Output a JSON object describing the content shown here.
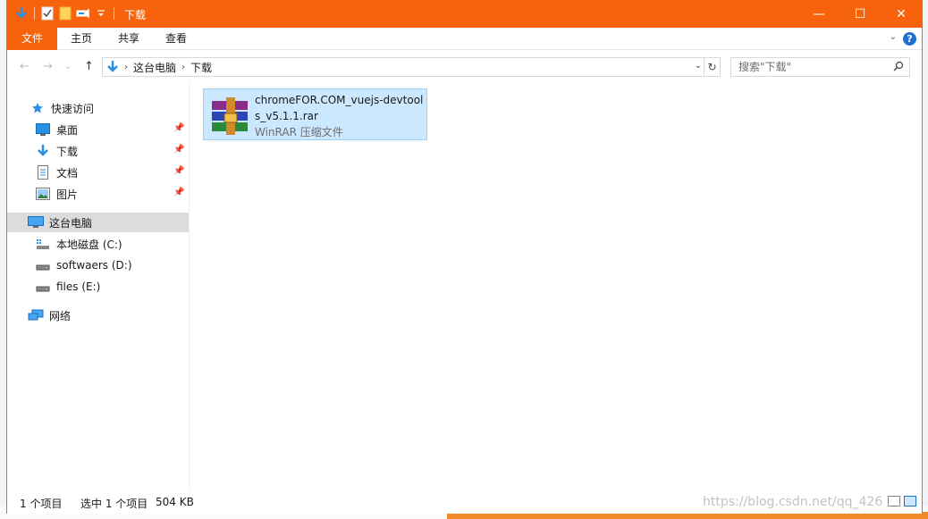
{
  "titlebar": {
    "title": "下载",
    "qat_icons": [
      "download-arrow-icon",
      "properties-check-icon",
      "new-folder-icon",
      "rename-icon",
      "customize-dropdown-icon"
    ],
    "controls": {
      "minimize": "—",
      "maximize": "☐",
      "close": "✕"
    }
  },
  "ribbon": {
    "tabs": [
      {
        "label": "文件",
        "active": true
      },
      {
        "label": "主页",
        "active": false
      },
      {
        "label": "共享",
        "active": false
      },
      {
        "label": "查看",
        "active": false
      }
    ],
    "help": "?"
  },
  "address": {
    "back": "←",
    "forward": "→",
    "recent": "⌄",
    "up": "↑",
    "breadcrumb": [
      "这台电脑",
      "下载"
    ],
    "separator": "›",
    "refresh": "↻"
  },
  "search": {
    "placeholder": "搜索\"下载\""
  },
  "nav": {
    "quick_access": {
      "label": "快速访问"
    },
    "pinned": [
      {
        "label": "桌面",
        "icon": "desktop-icon"
      },
      {
        "label": "下载",
        "icon": "downloads-icon"
      },
      {
        "label": "文档",
        "icon": "documents-icon"
      },
      {
        "label": "图片",
        "icon": "pictures-icon"
      }
    ],
    "this_pc": {
      "label": "这台电脑"
    },
    "drives": [
      {
        "label": "本地磁盘 (C:)",
        "icon": "system-drive-icon"
      },
      {
        "label": "softwaers (D:)",
        "icon": "drive-icon"
      },
      {
        "label": "files (E:)",
        "icon": "drive-icon"
      }
    ],
    "network": {
      "label": "网络"
    }
  },
  "files": [
    {
      "name": "chromeFOR.COM_vuejs-devtools_v5.1.1.rar",
      "type": "WinRAR 压缩文件",
      "icon": "winrar-archive-icon",
      "selected": true
    }
  ],
  "status": {
    "item_count": "1 个项目",
    "selection": "选中 1 个项目",
    "size": "504 KB"
  },
  "watermark": "https://blog.csdn.net/qq_426"
}
